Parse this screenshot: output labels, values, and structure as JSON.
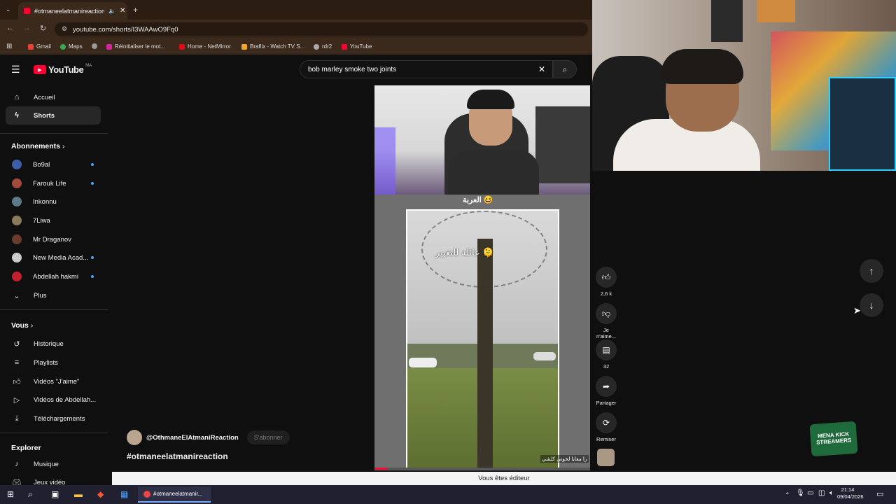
{
  "browser": {
    "tab_title": "#otmaneelatmanireaction",
    "url": "youtube.com/shorts/I3WAAwO9Fq0",
    "bookmarks": [
      "Gmail",
      "Maps",
      "Réinitialiser le mot...",
      "Home - NetMirror",
      "Braflix - Watch TV S...",
      "rdr2",
      "YouTube"
    ]
  },
  "youtube": {
    "logo_text": "YouTube",
    "region": "MA",
    "search_value": "bob marley smoke two joints"
  },
  "sidebar": {
    "nav": [
      {
        "label": "Accueil",
        "icon": "home-icon"
      },
      {
        "label": "Shorts",
        "icon": "shorts-icon"
      }
    ],
    "subscriptions_header": "Abonnements",
    "subscriptions": [
      {
        "label": "Bo9al",
        "color": "#3b5fa8",
        "dot": true
      },
      {
        "label": "Farouk Life",
        "color": "#a14b3c",
        "dot": true
      },
      {
        "label": "Inkonnu",
        "color": "#5c7c8a",
        "dot": false
      },
      {
        "label": "7Liwa",
        "color": "#8a7a5c",
        "dot": false
      },
      {
        "label": "Mr Draganov",
        "color": "#6b3b2e",
        "dot": false
      },
      {
        "label": "New Media Acad...",
        "color": "#cccccc",
        "dot": true
      },
      {
        "label": "Abdellah hakmi",
        "color": "#c2202f",
        "dot": true
      }
    ],
    "more_label": "Plus",
    "you_header": "Vous",
    "you_items": [
      {
        "label": "Historique",
        "icon": "history-icon"
      },
      {
        "label": "Playlists",
        "icon": "playlist-icon"
      },
      {
        "label": "Vidéos \"J'aime\"",
        "icon": "like-icon"
      },
      {
        "label": "Vidéos de Abdellah...",
        "icon": "video-icon"
      },
      {
        "label": "Téléchargements",
        "icon": "download-icon"
      }
    ],
    "explore_header": "Explorer",
    "explore_items": [
      {
        "label": "Musique",
        "icon": "music-icon"
      },
      {
        "label": "Jeux vidéo",
        "icon": "gaming-icon"
      }
    ]
  },
  "short": {
    "channel": "@OthmaneElAtmaniReaction",
    "subscribe_label": "S'abonner",
    "title": "#otmaneelatmanireaction",
    "video_caption_top": "العربة 😆",
    "video_caption_mid": "عائلة للتغيير 🫠",
    "video_caption_bottom": "را معايا لخوتي كلشي",
    "likes": "2,6 k",
    "dislike_label": "Je n'aime...",
    "comments": "32",
    "share_label": "Partager",
    "remix_label": "Remixer"
  },
  "overlay": {
    "editor_notice": "Vous êtes éditeur",
    "stream_logo": "MENA KICK STREAMERS"
  },
  "taskbar": {
    "active_app": "#otmaneelatmanir...",
    "time": "21:14",
    "date": "09/04/2026"
  }
}
